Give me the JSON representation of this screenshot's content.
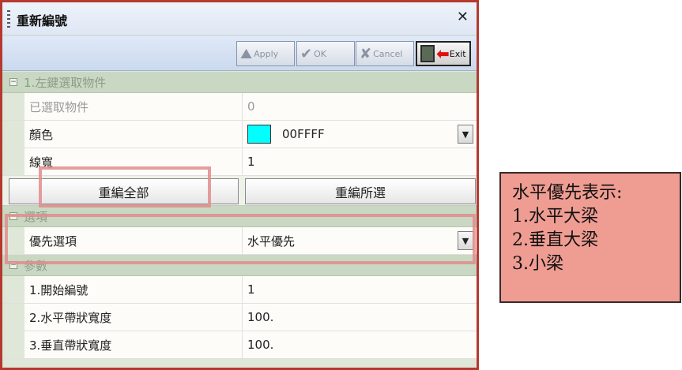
{
  "window": {
    "title": "重新編號"
  },
  "toolbar": {
    "apply": "Apply",
    "ok": "OK",
    "cancel": "Cancel",
    "exit": "Exit"
  },
  "sections": {
    "pick": {
      "header": "1.左鍵選取物件",
      "rows": [
        {
          "key": "已選取物件",
          "value": "0"
        },
        {
          "key": "顏色",
          "value": "00FFFF"
        },
        {
          "key": "線寬",
          "value": "1"
        }
      ],
      "buttons": {
        "renumber_all": "重編全部",
        "renumber_selected": "重編所選"
      }
    },
    "options": {
      "header": "選項",
      "rows": [
        {
          "key": "優先選項",
          "value": "水平優先"
        }
      ]
    },
    "params": {
      "header": "參數",
      "rows": [
        {
          "key": "1.開始編號",
          "value": "1"
        },
        {
          "key": "2.水平帶狀寬度",
          "value": "100."
        },
        {
          "key": "3.垂直帶狀寬度",
          "value": "100."
        }
      ]
    }
  },
  "colors": {
    "swatch": "#00FFFF",
    "accent_border": "#b5392f",
    "note_bg": "#ef9c92"
  },
  "note": {
    "lines": [
      "水平優先表示:",
      "1.水平大梁",
      "2.垂直大梁",
      "3.小梁"
    ]
  }
}
